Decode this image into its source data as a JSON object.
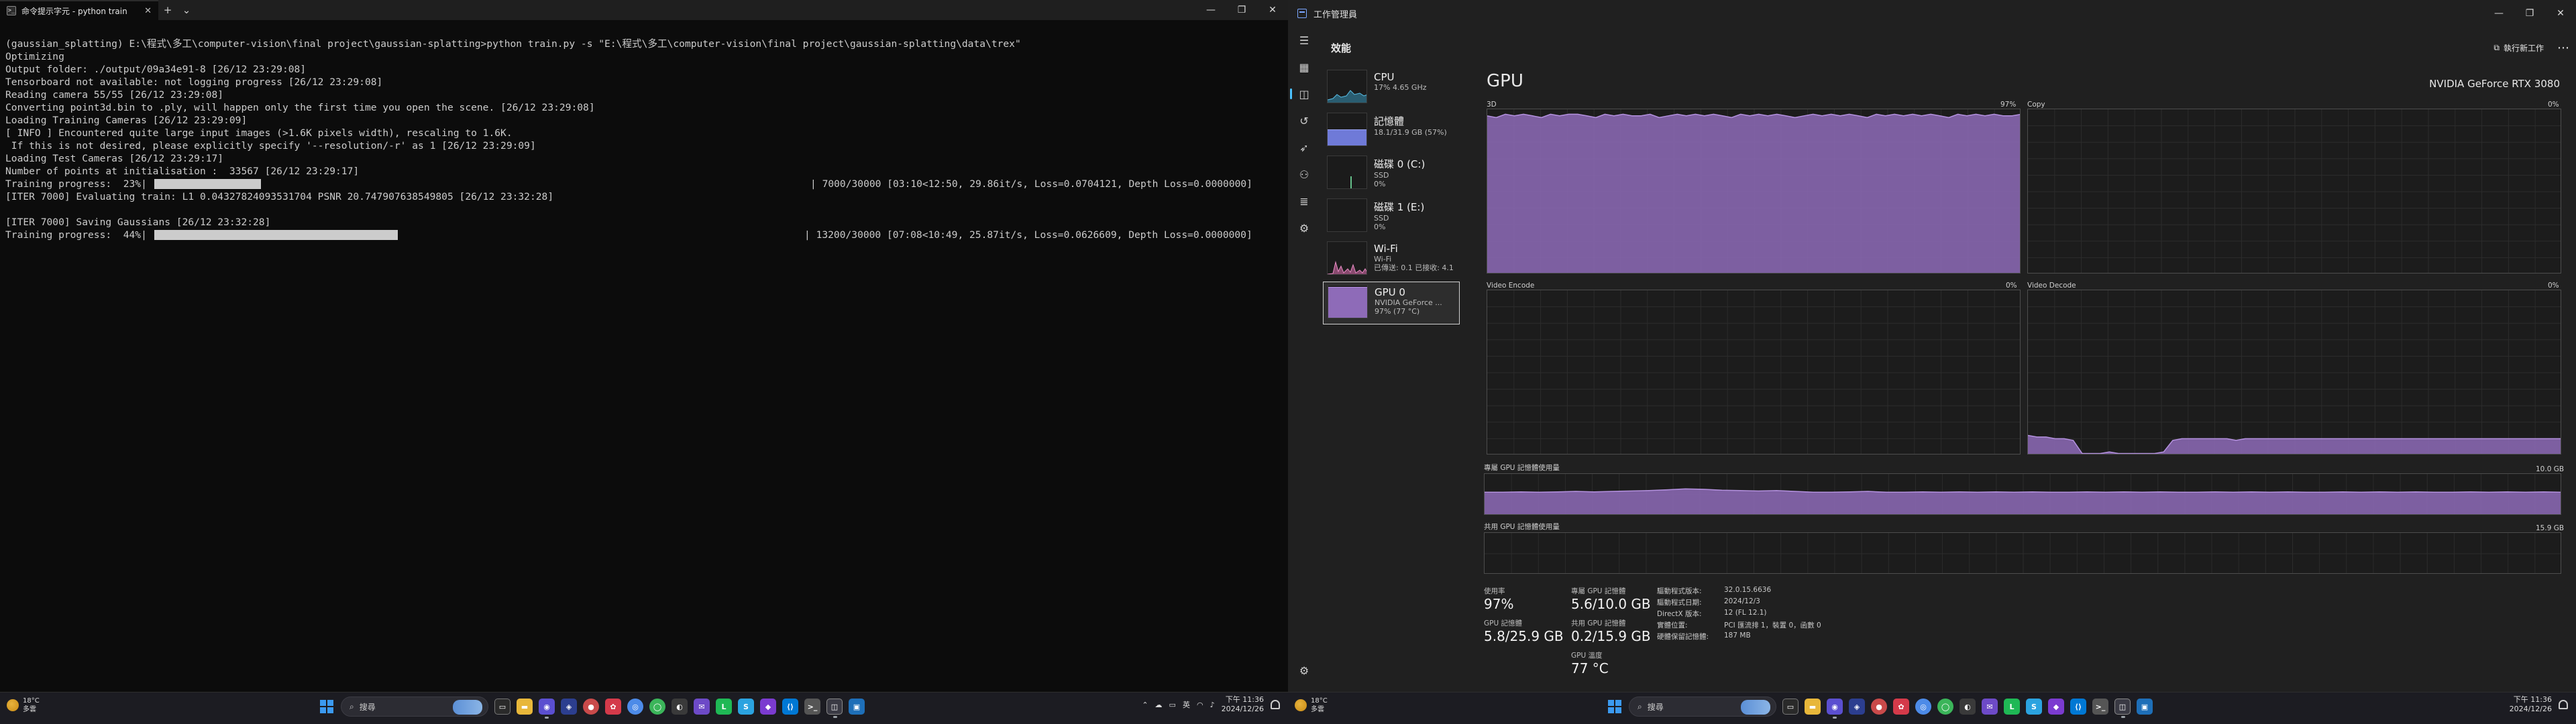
{
  "terminal": {
    "tab_title": "命令提示字元 - python  train",
    "lines": [
      "(gaussian_splatting) E:\\程式\\多工\\computer-vision\\final project\\gaussian-splatting>python train.py -s \"E:\\程式\\多工\\computer-vision\\final project\\gaussian-splatting\\data\\trex\"",
      "Optimizing",
      "Output folder: ./output/09a34e91-8 [26/12 23:29:08]",
      "Tensorboard not available: not logging progress [26/12 23:29:08]",
      "Reading camera 55/55 [26/12 23:29:08]",
      "Converting point3d.bin to .ply, will happen only the first time you open the scene. [26/12 23:29:08]",
      "Loading Training Cameras [26/12 23:29:09]",
      "[ INFO ] Encountered quite large input images (>1.6K pixels width), rescaling to 1.6K.",
      " If this is not desired, please explicitly specify '--resolution/-r' as 1 [26/12 23:29:09]",
      "Loading Test Cameras [26/12 23:29:17]",
      "Number of points at initialisation :  33567 [26/12 23:29:17]"
    ],
    "progress1": {
      "label": "Training progress:  23%|",
      "fraction": 0.23,
      "stats": "| 7000/30000 [03:10<12:50, 29.86it/s, Loss=0.0704121, Depth Loss=0.0000000]"
    },
    "evaluating": "[ITER 7000] Evaluating train: L1 0.04327824093531704 PSNR 20.747907638549805 [26/12 23:32:28]",
    "blank": "",
    "saving": "[ITER 7000] Saving Gaussians [26/12 23:32:28]",
    "progress2": {
      "label": "Training progress:  44%|",
      "fraction": 0.44,
      "stats": "| 13200/30000 [07:08<10:49, 25.87it/s, Loss=0.0626609, Depth Loss=0.0000000]"
    }
  },
  "taskmgr": {
    "window_title": "工作管理員",
    "page_name": "效能",
    "run_task": "執行新工作",
    "devices": [
      {
        "name": "CPU",
        "sub1": "17%  4.65 GHz",
        "sub2": ""
      },
      {
        "name": "記憶體",
        "sub1": "18.1/31.9 GB (57%)",
        "sub2": ""
      },
      {
        "name": "磁碟 0 (C:)",
        "sub1": "SSD",
        "sub2": "0%"
      },
      {
        "name": "磁碟 1 (E:)",
        "sub1": "SSD",
        "sub2": "0%"
      },
      {
        "name": "Wi-Fi",
        "sub1": "Wi-Fi",
        "sub2": "已傳送: 0.1 已接收: 4.1"
      },
      {
        "name": "GPU 0",
        "sub1": "NVIDIA GeForce ...",
        "sub2": "97% (77 °C)"
      }
    ],
    "gpu_title": "GPU",
    "gpu_model": "NVIDIA GeForce RTX 3080",
    "graphs": {
      "g3d": {
        "label": "3D",
        "max": "97%"
      },
      "copy": {
        "label": "Copy",
        "max": "0%"
      },
      "encode": {
        "label": "Video Encode",
        "max": "0%"
      },
      "decode": {
        "label": "Video Decode",
        "max": "0%"
      },
      "dedicated": {
        "label": "專屬 GPU 記憶體使用量",
        "max": "10.0 GB"
      },
      "shared": {
        "label": "共用 GPU 記憶體使用量",
        "max": "15.9 GB"
      }
    },
    "stats": {
      "util_label": "使用率",
      "util_value": "97%",
      "ded_label": "專屬 GPU 記憶體",
      "ded_value": "5.6/10.0 GB",
      "gpumem_label": "GPU 記憶體",
      "gpumem_value": "5.8/25.9 GB",
      "shared_label": "共用 GPU 記憶體",
      "shared_value": "0.2/15.9 GB",
      "temp_label": "GPU 溫度",
      "temp_value": "77 °C"
    },
    "props": [
      {
        "k": "驅動程式版本:",
        "v": "32.0.15.6636"
      },
      {
        "k": "驅動程式日期:",
        "v": "2024/12/3"
      },
      {
        "k": "DirectX 版本:",
        "v": "12 (FL 12.1)"
      },
      {
        "k": "實體位置:",
        "v": "PCI 匯流排 1，裝置 0，函數 0"
      },
      {
        "k": "硬體保留記憶體:",
        "v": "187 MB"
      }
    ],
    "series": {
      "g3d": [
        96,
        95,
        97,
        96,
        97,
        96,
        95,
        97,
        96,
        97,
        97,
        96,
        95,
        97,
        96,
        97,
        96,
        96,
        97,
        95,
        96,
        97,
        96,
        97,
        96,
        97,
        96,
        95,
        97,
        96,
        97,
        96,
        97,
        96,
        95,
        96,
        97,
        96,
        97,
        96,
        97,
        96,
        95,
        97,
        96,
        97,
        96,
        97,
        96,
        97,
        96,
        95,
        97,
        96,
        97,
        96,
        97,
        96,
        96,
        97
      ],
      "decode": [
        12,
        11,
        11,
        10,
        10,
        9,
        1,
        1,
        1,
        2,
        1,
        1,
        1,
        1,
        1,
        2,
        9,
        10,
        10,
        10,
        10,
        10,
        10,
        9,
        10,
        10,
        10,
        10,
        10,
        10,
        10,
        10,
        10,
        10,
        10,
        10,
        10,
        10,
        10,
        10,
        10,
        10,
        10,
        10,
        10,
        10,
        10,
        10,
        10,
        10,
        10,
        10,
        10,
        10,
        10,
        10,
        10,
        10,
        10,
        10
      ],
      "dedicated": [
        56,
        56,
        57,
        56,
        57,
        58,
        57,
        58,
        59,
        60,
        62,
        64,
        63,
        61,
        60,
        59,
        60,
        58,
        56,
        56,
        57,
        58,
        56,
        56,
        57,
        56,
        57,
        56,
        57,
        56,
        57,
        56,
        56,
        57,
        56,
        57,
        56,
        57,
        56,
        56,
        57,
        56,
        57,
        56,
        57,
        56,
        56,
        57,
        56,
        57,
        56,
        57,
        56,
        56,
        57,
        56,
        57,
        56,
        57,
        56
      ],
      "shared": [
        2,
        2,
        2,
        2,
        2,
        2,
        2,
        2,
        2,
        2,
        2,
        2,
        2,
        2,
        2,
        2,
        2,
        2,
        2,
        2,
        2,
        2,
        2,
        2,
        2,
        2,
        2,
        2,
        2,
        2,
        2,
        2,
        2,
        2,
        2,
        2,
        2,
        2,
        2,
        2,
        2,
        2,
        2,
        2,
        2,
        2,
        2,
        2,
        2,
        2,
        2,
        2,
        2,
        2,
        2,
        2,
        2,
        2,
        2,
        2
      ]
    },
    "colors": {
      "gpu_fill": "#8e6bb8",
      "gpu_line": "#b592e0",
      "cpu_fill": "#3aa0c8",
      "mem_fill": "#7a86e0",
      "wifi_fill": "#d46aa8"
    }
  },
  "taskbar": {
    "weather_temp": "18°C",
    "weather_desc": "多雲",
    "search": "搜尋",
    "ime": "英",
    "time": "下午 11:36",
    "date": "2024/12/26"
  }
}
